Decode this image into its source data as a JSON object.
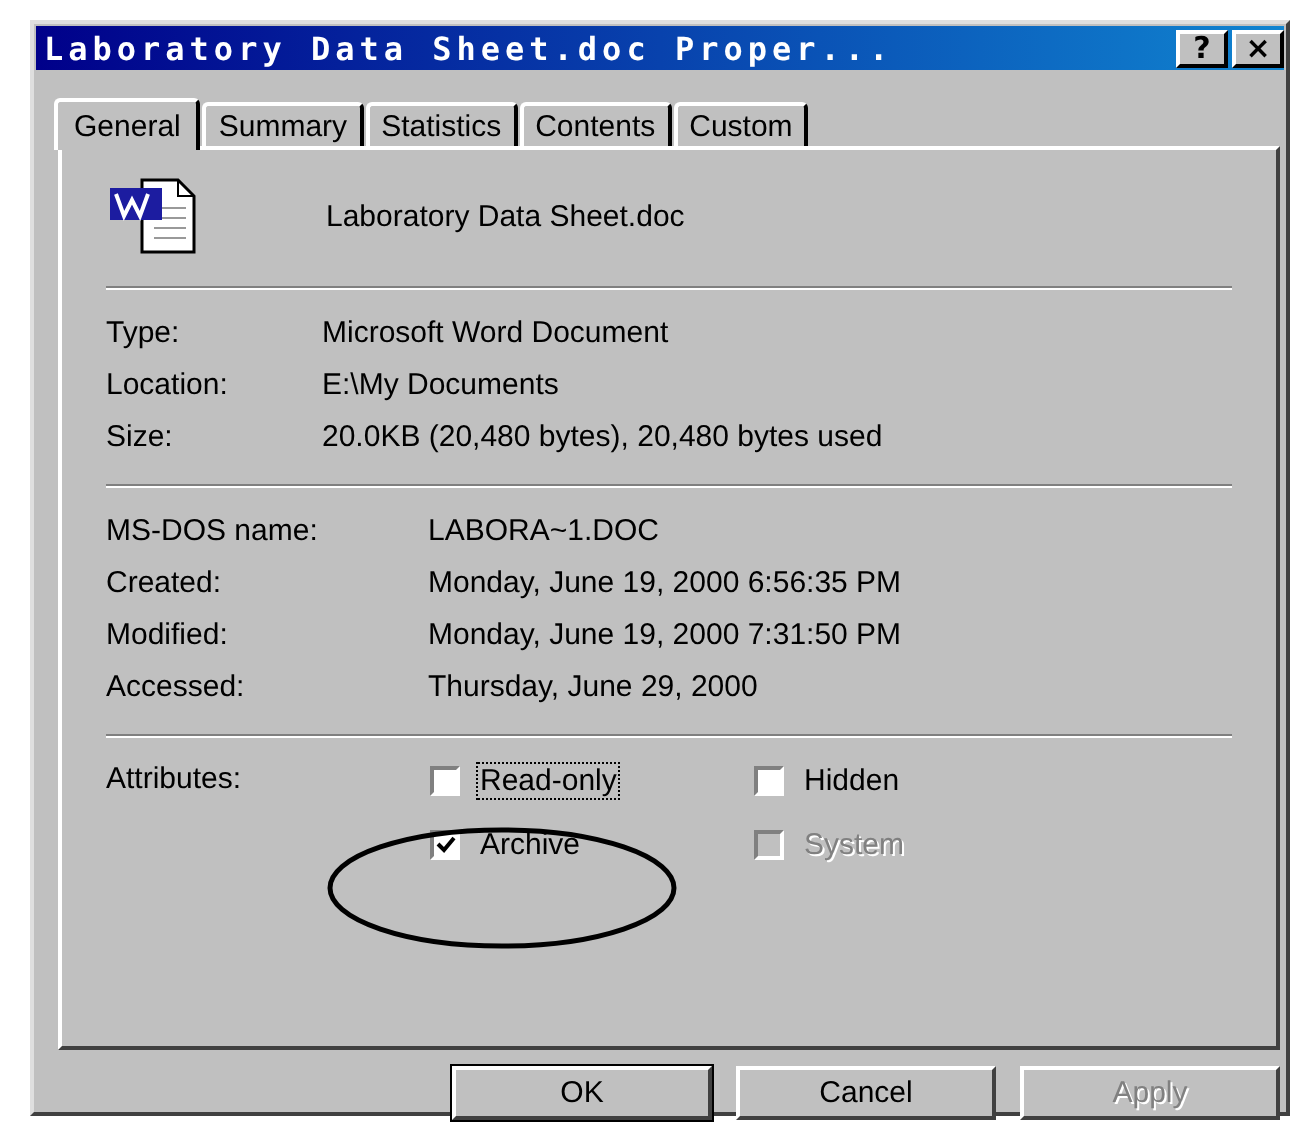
{
  "window": {
    "title": "Laboratory Data Sheet.doc Proper...",
    "help_button": "?",
    "close_button": "×"
  },
  "tabs": [
    {
      "label": "General",
      "selected": true
    },
    {
      "label": "Summary",
      "selected": false
    },
    {
      "label": "Statistics",
      "selected": false
    },
    {
      "label": "Contents",
      "selected": false
    },
    {
      "label": "Custom",
      "selected": false
    }
  ],
  "file_name": "Laboratory Data Sheet.doc",
  "info_groups": [
    {
      "rows": [
        {
          "label": "Type:",
          "value": "Microsoft Word Document"
        },
        {
          "label": "Location:",
          "value": "E:\\My Documents"
        },
        {
          "label": "Size:",
          "value": "20.0KB (20,480 bytes), 20,480 bytes used"
        }
      ]
    },
    {
      "rows": [
        {
          "label": "MS-DOS name:",
          "value": "LABORA~1.DOC"
        },
        {
          "label": "Created:",
          "value": "Monday, June 19, 2000 6:56:35 PM"
        },
        {
          "label": "Modified:",
          "value": "Monday, June 19, 2000 7:31:50 PM"
        },
        {
          "label": "Accessed:",
          "value": "Thursday, June 29, 2000"
        }
      ]
    }
  ],
  "attributes": {
    "label": "Attributes:",
    "options": [
      {
        "label": "Read-only",
        "checked": false,
        "disabled": false,
        "focused": true
      },
      {
        "label": "Hidden",
        "checked": false,
        "disabled": false,
        "focused": false
      },
      {
        "label": "Archive",
        "checked": true,
        "disabled": false,
        "focused": false
      },
      {
        "label": "System",
        "checked": false,
        "disabled": true,
        "focused": false
      }
    ]
  },
  "buttons": [
    {
      "label": "OK",
      "default": true,
      "disabled": false
    },
    {
      "label": "Cancel",
      "default": false,
      "disabled": false
    },
    {
      "label": "Apply",
      "default": false,
      "disabled": true
    }
  ]
}
